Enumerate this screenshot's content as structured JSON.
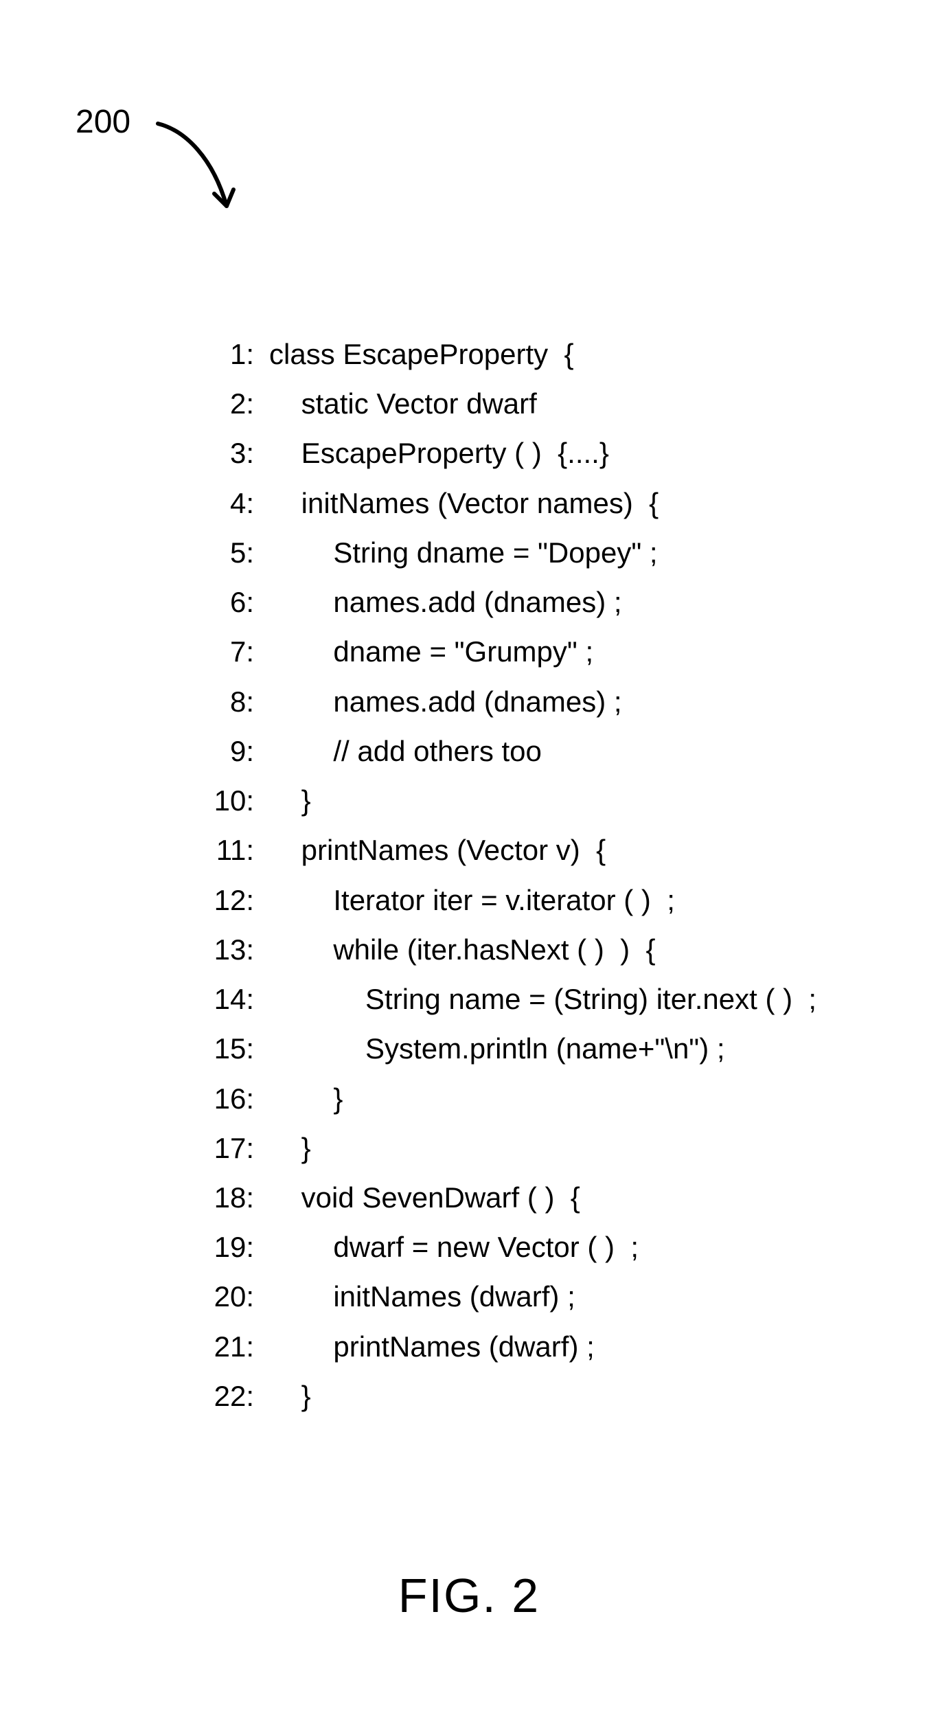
{
  "ref": "200",
  "caption": "FIG. 2",
  "code": {
    "lines": [
      {
        "n": "1:",
        "text": "class EscapeProperty  {"
      },
      {
        "n": "2:",
        "text": "    static Vector dwarf"
      },
      {
        "n": "3:",
        "text": "    EscapeProperty ( )  {....}"
      },
      {
        "n": "4:",
        "text": "    initNames (Vector names)  {"
      },
      {
        "n": "5:",
        "text": "        String dname = \"Dopey\" ;"
      },
      {
        "n": "6:",
        "text": "        names.add (dnames) ;"
      },
      {
        "n": "7:",
        "text": "        dname = \"Grumpy\" ;"
      },
      {
        "n": "8:",
        "text": "        names.add (dnames) ;"
      },
      {
        "n": "9:",
        "text": "        // add others too"
      },
      {
        "n": "10:",
        "text": "    }"
      },
      {
        "n": "11:",
        "text": "    printNames (Vector v)  {"
      },
      {
        "n": "12:",
        "text": "        Iterator iter = v.iterator ( )  ;"
      },
      {
        "n": "13:",
        "text": "        while (iter.hasNext ( )  )  {"
      },
      {
        "n": "14:",
        "text": "            String name = (String) iter.next ( )  ;"
      },
      {
        "n": "15:",
        "text": "            System.println (name+\"\\n\") ;"
      },
      {
        "n": "16:",
        "text": "        }"
      },
      {
        "n": "17:",
        "text": "    }"
      },
      {
        "n": "18:",
        "text": "    void SevenDwarf ( )  {"
      },
      {
        "n": "19:",
        "text": "        dwarf = new Vector ( )  ;"
      },
      {
        "n": "20:",
        "text": "        initNames (dwarf) ;"
      },
      {
        "n": "21:",
        "text": "        printNames (dwarf) ;"
      },
      {
        "n": "22:",
        "text": "    }"
      }
    ]
  }
}
